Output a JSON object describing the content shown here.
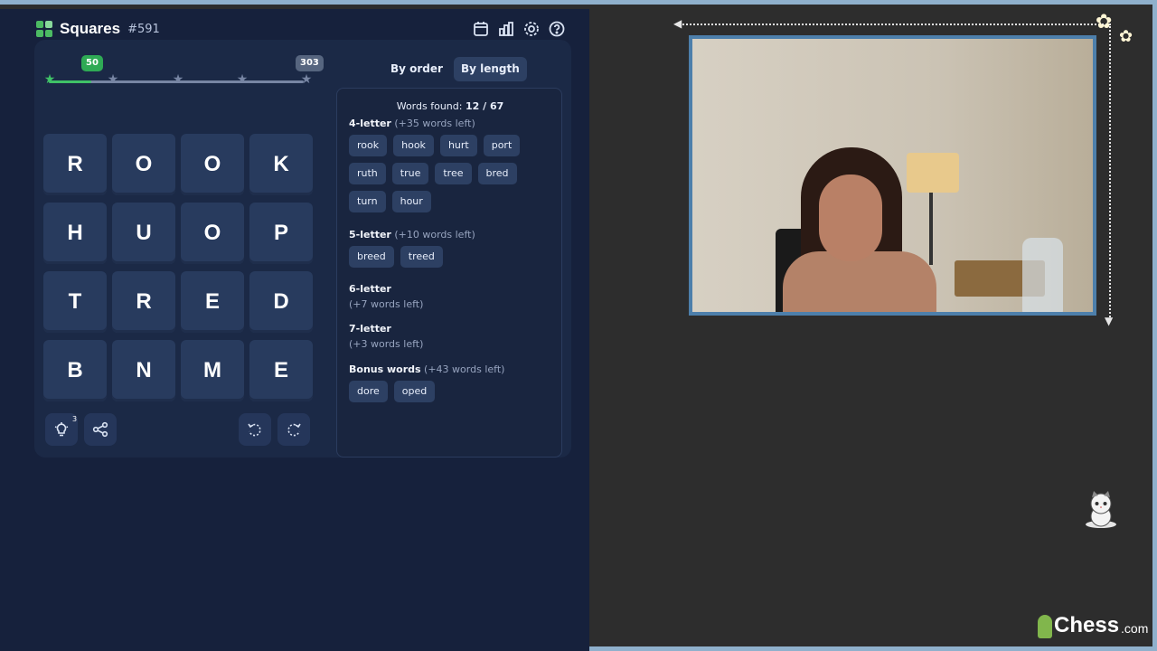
{
  "header": {
    "title": "Squares",
    "puzzle_number": "#591",
    "icons": [
      "calendar-icon",
      "stats-icon",
      "settings-icon",
      "help-icon"
    ]
  },
  "progress": {
    "current_score": "50",
    "max_score": "303",
    "fraction": 0.165,
    "milestones": 5
  },
  "grid": {
    "letters": [
      [
        "R",
        "O",
        "O",
        "K"
      ],
      [
        "H",
        "U",
        "O",
        "P"
      ],
      [
        "T",
        "R",
        "E",
        "D"
      ],
      [
        "B",
        "N",
        "M",
        "E"
      ]
    ]
  },
  "controls": {
    "hint_count": "3"
  },
  "sort": {
    "by_order": "By order",
    "by_length": "By length",
    "active": "By length"
  },
  "words": {
    "found_label": "Words found:",
    "found_count": "12 / 67",
    "sections": [
      {
        "title": "4-letter",
        "left": "(+35 words left)",
        "words": [
          "rook",
          "hook",
          "hurt",
          "port",
          "ruth",
          "true",
          "tree",
          "bred",
          "turn",
          "hour"
        ]
      },
      {
        "title": "5-letter",
        "left": "(+10 words left)",
        "words": [
          "breed",
          "treed"
        ]
      },
      {
        "title": "6-letter",
        "left": "(+7 words left)",
        "words": []
      },
      {
        "title": "7-letter",
        "left": "(+3 words left)",
        "words": []
      },
      {
        "title": "Bonus words",
        "left": "(+43 words left)",
        "words": [
          "dore",
          "oped"
        ]
      }
    ]
  },
  "brand": {
    "name": "Chess",
    "suffix": ".com"
  },
  "colors": {
    "panel_bg": "#16213c",
    "tile_bg": "#283b5e",
    "accent_green": "#3fc267",
    "stream_frame": "#4d7fab",
    "background": "#2d2d2d"
  }
}
